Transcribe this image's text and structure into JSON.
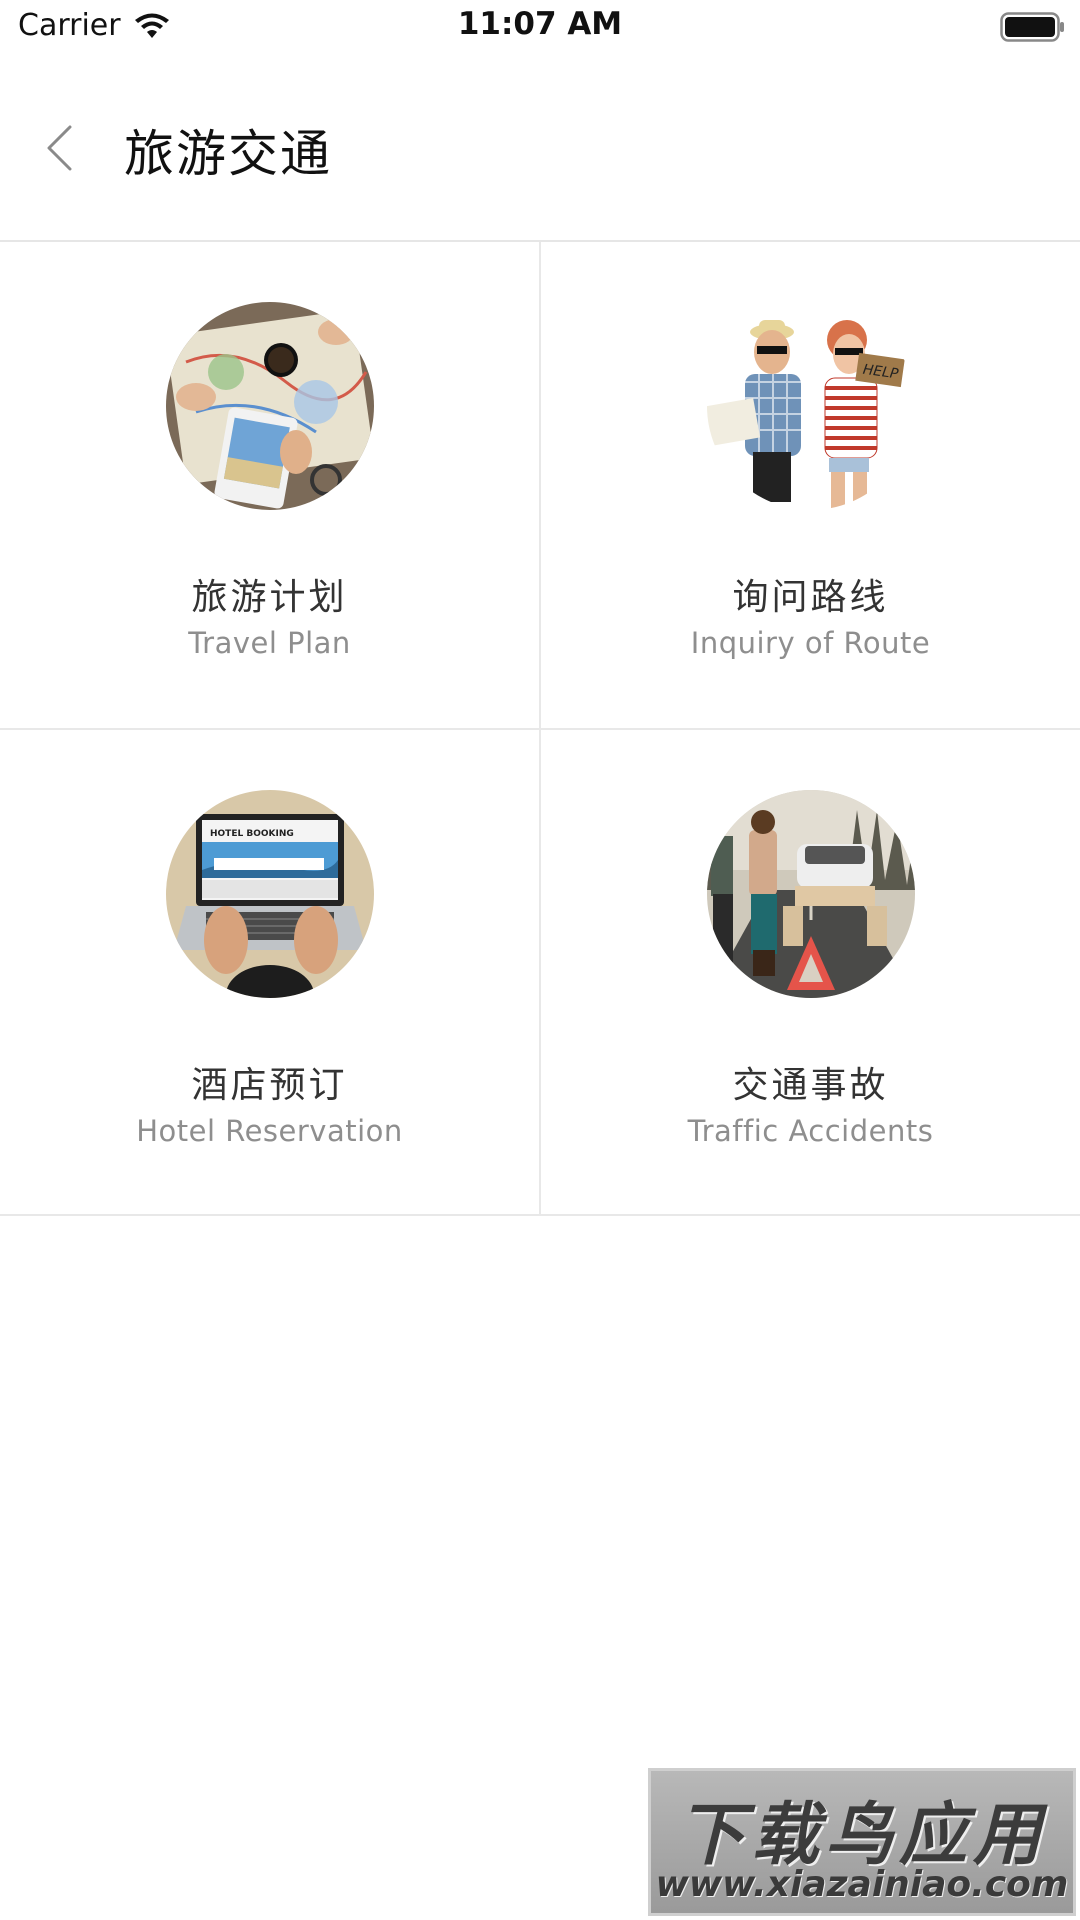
{
  "status_bar": {
    "carrier": "Carrier",
    "time": "11:07 AM",
    "wifi_icon": "wifi-icon",
    "battery_icon": "battery-full-icon"
  },
  "nav": {
    "back_icon": "chevron-left-icon",
    "title": "旅游交通"
  },
  "items": [
    {
      "title": "旅游计划",
      "subtitle": "Travel Plan",
      "image": "travel-map-photo"
    },
    {
      "title": "询问路线",
      "subtitle": "Inquiry of Route",
      "image": "hitchhikers-help-sign-photo"
    },
    {
      "title": "酒店预订",
      "subtitle": "Hotel Reservation",
      "image": "laptop-hotel-booking-photo"
    },
    {
      "title": "交通事故",
      "subtitle": "Traffic Accidents",
      "image": "roadside-car-breakdown-photo"
    }
  ],
  "hotel_screen_text": "HOTEL BOOKING",
  "help_sign_text": "HELP",
  "watermark": {
    "line1": "下载鸟应用",
    "line2": "www.xiazainiao.com"
  },
  "colors": {
    "divider": "#e8e8e8",
    "subtitle": "#8e8e8e",
    "title": "#333333"
  }
}
